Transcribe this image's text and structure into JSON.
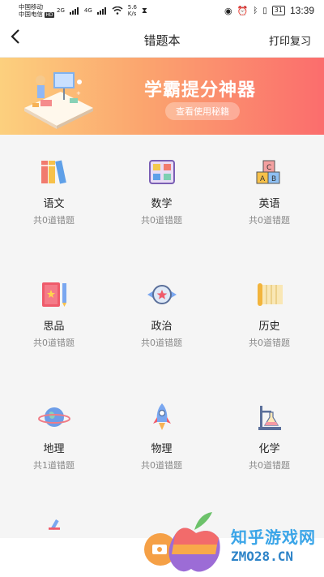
{
  "status_bar": {
    "carrier1": "中国移动",
    "carrier2": "中国电信",
    "hd": "HD",
    "net1": "2G",
    "net2": "4G",
    "speed": "5.6\nK/s",
    "battery": "31",
    "time": "13:39"
  },
  "nav": {
    "back": "<",
    "title": "错题本",
    "print": "打印复习"
  },
  "banner": {
    "title": "学霸提分神器",
    "button": "查看使用秘籍"
  },
  "subjects": [
    {
      "name": "语文",
      "count": "共0道错题",
      "icon": "books-icon"
    },
    {
      "name": "数学",
      "count": "共0道错题",
      "icon": "calculator-icon"
    },
    {
      "name": "英语",
      "count": "共0道错题",
      "icon": "abc-blocks-icon"
    },
    {
      "name": "思品",
      "count": "共0道错题",
      "icon": "book-pencil-icon"
    },
    {
      "name": "政治",
      "count": "共0道错题",
      "icon": "emblem-icon"
    },
    {
      "name": "历史",
      "count": "共0道错题",
      "icon": "scroll-icon"
    },
    {
      "name": "地理",
      "count": "共1道错题",
      "icon": "planet-icon"
    },
    {
      "name": "物理",
      "count": "共0道错题",
      "icon": "rocket-icon"
    },
    {
      "name": "化学",
      "count": "共0道错题",
      "icon": "flask-icon"
    }
  ],
  "watermark": {
    "text": "知乎游戏网",
    "domain": "ZMO28.CN"
  },
  "colors": {
    "banner_start": "#fcd07e",
    "banner_end": "#fb6d6d",
    "watermark": "#3aa5e8"
  }
}
